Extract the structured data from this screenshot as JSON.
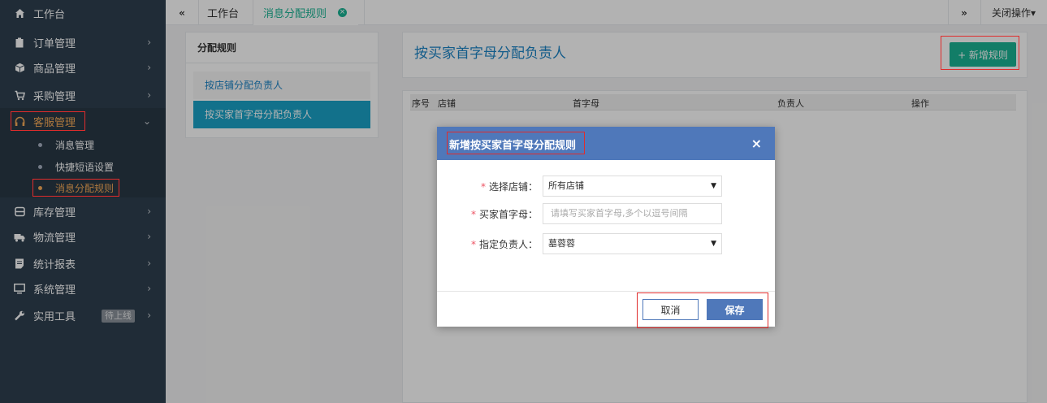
{
  "sidebar": {
    "items": [
      {
        "label": "工作台",
        "icon": "home-icon"
      },
      {
        "label": "订单管理",
        "icon": "clipboard-icon"
      },
      {
        "label": "商品管理",
        "icon": "cube-icon"
      },
      {
        "label": "采购管理",
        "icon": "cart-icon"
      },
      {
        "label": "客服管理",
        "icon": "headset-icon"
      },
      {
        "label": "库存管理",
        "icon": "storage-icon"
      },
      {
        "label": "物流管理",
        "icon": "truck-icon"
      },
      {
        "label": "统计报表",
        "icon": "report-icon"
      },
      {
        "label": "系统管理",
        "icon": "monitor-icon"
      },
      {
        "label": "实用工具",
        "icon": "wrench-icon",
        "badge": "待上线"
      }
    ],
    "submenu": [
      {
        "label": "消息管理"
      },
      {
        "label": "快捷短语设置"
      },
      {
        "label": "消息分配规则"
      }
    ],
    "arrow_right": "›",
    "arrow_down": "⌄"
  },
  "topbar": {
    "back_icon": "«",
    "tabs": [
      {
        "label": "工作台"
      },
      {
        "label": "消息分配规则"
      }
    ],
    "forward_icon": "»",
    "close_ops": "关闭操作▾"
  },
  "left_panel": {
    "title": "分配规则",
    "rules": [
      {
        "label": "按店铺分配负责人"
      },
      {
        "label": "按买家首字母分配负责人"
      }
    ]
  },
  "main": {
    "title": "按买家首字母分配负责人",
    "add_button": "+ 新增规则",
    "columns": [
      "序号",
      "店铺",
      "首字母",
      "负责人",
      "操作"
    ]
  },
  "modal": {
    "title": "新增按买家首字母分配规则",
    "close": "×",
    "fields": {
      "shop_label": "选择店铺：",
      "shop_value": "所有店铺",
      "initial_label": "买家首字母：",
      "initial_placeholder": "请填写买家首字母,多个以逗号间隔",
      "owner_label": "指定负责人：",
      "owner_value": "墓蓉蓉"
    },
    "required_mark": "*",
    "cancel": "取消",
    "save": "保存"
  },
  "colors": {
    "sidebar_bg": "#2f4050",
    "accent_green": "#1ab394",
    "modal_blue": "#4f78ba",
    "highlight_red": "#e02c2c",
    "active_orange": "#f8ac59"
  }
}
